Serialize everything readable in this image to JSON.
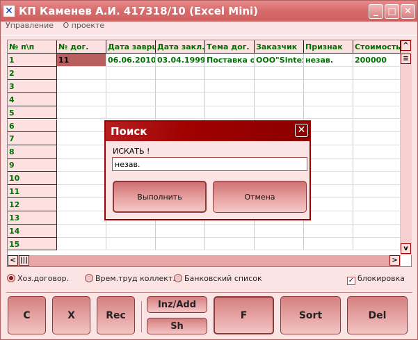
{
  "window": {
    "title": "КП Каменев А.И. 417318/10 (Excel Mini)",
    "icon": "tools-icon"
  },
  "menu": [
    "Управление",
    "О проекте"
  ],
  "table": {
    "row_header": "№ п\\п",
    "columns": [
      "№ дог.",
      "Дата заврш",
      "Дата закл.",
      "Тема дог.",
      "Заказчик",
      "Признак",
      "Стоимость"
    ],
    "rows": [
      [
        "11",
        "06.06.2010",
        "03.04.1999",
        "Поставка об",
        "ООО\"Sintex\"",
        "незав.",
        "200000"
      ]
    ],
    "row_numbers": [
      "1",
      "2",
      "3",
      "4",
      "5",
      "6",
      "7",
      "8",
      "9",
      "10",
      "11",
      "12",
      "13",
      "14",
      "15"
    ]
  },
  "options": {
    "radio1": "Хоз.договор.",
    "radio2": "Врем.труд коллект.",
    "radio3": "Банковский список",
    "checkbox": "блокировка",
    "selected": "radio1",
    "checked": true
  },
  "buttons": {
    "c": "C",
    "x": "X",
    "rec": "Rec",
    "inz": "Inz/Add",
    "sh": "Sh",
    "f": "F",
    "sort": "Sort",
    "del": "Del"
  },
  "dialog": {
    "title": "Поиск",
    "label": "ИСКАТЬ !",
    "value": "незав.",
    "ok": "Выполнить",
    "cancel": "Отмена"
  }
}
